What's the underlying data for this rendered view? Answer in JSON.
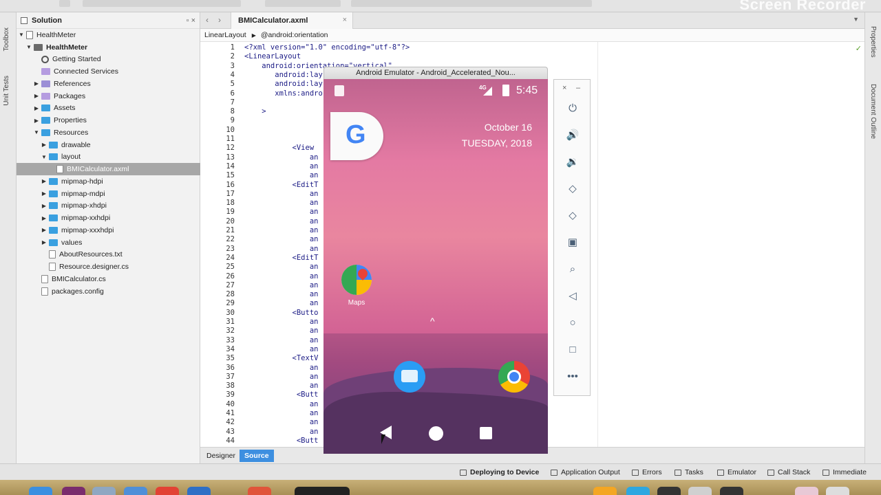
{
  "watermark": "Screen Recorder",
  "left_strip": {
    "tabs": [
      "Toolbox",
      "Unit Tests"
    ]
  },
  "right_strip": {
    "tabs": [
      "Properties",
      "Document Outline"
    ]
  },
  "solution": {
    "title": "Solution",
    "items": [
      {
        "label": "HealthMeter",
        "indent": 0,
        "arrow": "▼",
        "icon": "sln",
        "bold": false
      },
      {
        "label": "HealthMeter",
        "indent": 1,
        "arrow": "▼",
        "icon": "proj",
        "bold": true
      },
      {
        "label": "Getting Started",
        "indent": 2,
        "arrow": "",
        "icon": "gear",
        "bold": false
      },
      {
        "label": "Connected Services",
        "indent": 2,
        "arrow": "",
        "icon": "pkg",
        "bold": false
      },
      {
        "label": "References",
        "indent": 2,
        "arrow": "▶",
        "icon": "ref",
        "bold": false
      },
      {
        "label": "Packages",
        "indent": 2,
        "arrow": "▶",
        "icon": "pkg",
        "bold": false
      },
      {
        "label": "Assets",
        "indent": 2,
        "arrow": "▶",
        "icon": "folder",
        "bold": false
      },
      {
        "label": "Properties",
        "indent": 2,
        "arrow": "▶",
        "icon": "folder",
        "bold": false
      },
      {
        "label": "Resources",
        "indent": 2,
        "arrow": "▼",
        "icon": "folder",
        "bold": false
      },
      {
        "label": "drawable",
        "indent": 3,
        "arrow": "▶",
        "icon": "folder",
        "bold": false
      },
      {
        "label": "layout",
        "indent": 3,
        "arrow": "▼",
        "icon": "folder",
        "bold": false
      },
      {
        "label": "BMICalculator.axml",
        "indent": 4,
        "arrow": "",
        "icon": "file",
        "bold": false,
        "selected": true
      },
      {
        "label": "mipmap-hdpi",
        "indent": 3,
        "arrow": "▶",
        "icon": "folder",
        "bold": false
      },
      {
        "label": "mipmap-mdpi",
        "indent": 3,
        "arrow": "▶",
        "icon": "folder",
        "bold": false
      },
      {
        "label": "mipmap-xhdpi",
        "indent": 3,
        "arrow": "▶",
        "icon": "folder",
        "bold": false
      },
      {
        "label": "mipmap-xxhdpi",
        "indent": 3,
        "arrow": "▶",
        "icon": "folder",
        "bold": false
      },
      {
        "label": "mipmap-xxxhdpi",
        "indent": 3,
        "arrow": "▶",
        "icon": "folder",
        "bold": false
      },
      {
        "label": "values",
        "indent": 3,
        "arrow": "▶",
        "icon": "folder",
        "bold": false
      },
      {
        "label": "AboutResources.txt",
        "indent": 3,
        "arrow": "",
        "icon": "file",
        "bold": false
      },
      {
        "label": "Resource.designer.cs",
        "indent": 3,
        "arrow": "",
        "icon": "file",
        "bold": false
      },
      {
        "label": "BMICalculator.cs",
        "indent": 2,
        "arrow": "",
        "icon": "file",
        "bold": false
      },
      {
        "label": "packages.config",
        "indent": 2,
        "arrow": "",
        "icon": "file",
        "bold": false
      }
    ]
  },
  "editor": {
    "tab_label": "BMICalculator.axml",
    "tab_close": "×",
    "path": [
      "LinearLayout",
      "@android:orientation"
    ],
    "lines": [
      {
        "n": "1",
        "text": "<?xml version=\"1.0\" encoding=\"utf-8\"?>"
      },
      {
        "n": "2",
        "text": "<LinearLayout"
      },
      {
        "n": "3",
        "text": "    android:orientation=\"vertical\""
      },
      {
        "n": "4",
        "text": "       android:lay"
      },
      {
        "n": "5",
        "text": "       android:lay"
      },
      {
        "n": "6",
        "text": "       xmlns:andro"
      },
      {
        "n": "7",
        "text": ""
      },
      {
        "n": "8",
        "text": "    >"
      },
      {
        "n": "9",
        "text": ""
      },
      {
        "n": "10",
        "text": ""
      },
      {
        "n": "11",
        "text": ""
      },
      {
        "n": "12",
        "text": "           <View"
      },
      {
        "n": "13",
        "text": "               an"
      },
      {
        "n": "14",
        "text": "               an"
      },
      {
        "n": "15",
        "text": "               an"
      },
      {
        "n": "16",
        "text": "           <EditT"
      },
      {
        "n": "17",
        "text": "               an"
      },
      {
        "n": "18",
        "text": "               an"
      },
      {
        "n": "19",
        "text": "               an"
      },
      {
        "n": "20",
        "text": "               an"
      },
      {
        "n": "21",
        "text": "               an"
      },
      {
        "n": "22",
        "text": "               an"
      },
      {
        "n": "23",
        "text": "               an"
      },
      {
        "n": "24",
        "text": "           <EditT"
      },
      {
        "n": "25",
        "text": "               an"
      },
      {
        "n": "26",
        "text": "               an"
      },
      {
        "n": "27",
        "text": "               an"
      },
      {
        "n": "28",
        "text": "               an"
      },
      {
        "n": "29",
        "text": "               an"
      },
      {
        "n": "30",
        "text": "           <Butto"
      },
      {
        "n": "31",
        "text": "               an"
      },
      {
        "n": "32",
        "text": "               an"
      },
      {
        "n": "33",
        "text": "               an"
      },
      {
        "n": "34",
        "text": "               an"
      },
      {
        "n": "35",
        "text": "           <TextV"
      },
      {
        "n": "36",
        "text": "               an"
      },
      {
        "n": "37",
        "text": "               an"
      },
      {
        "n": "38",
        "text": "               an"
      },
      {
        "n": "39",
        "text": "            <Butt"
      },
      {
        "n": "40",
        "text": "               an"
      },
      {
        "n": "41",
        "text": "               an"
      },
      {
        "n": "42",
        "text": "               an"
      },
      {
        "n": "43",
        "text": "               an"
      },
      {
        "n": "44",
        "text": "            <Butt"
      }
    ],
    "bottom_tabs": [
      "Designer",
      "Source"
    ]
  },
  "status": {
    "items": [
      "Deploying to Device",
      "Application Output",
      "Errors",
      "Tasks",
      "Emulator",
      "Call Stack",
      "Immediate"
    ]
  },
  "emulator": {
    "title": "Android Emulator - Android_Accelerated_Nou...",
    "status_network": "4G",
    "time": "5:45",
    "google_letter": "G",
    "date_line1": "October 16",
    "date_line2": "TUESDAY, 2018",
    "app_maps_label": "Maps",
    "side_close": "×",
    "side_min": "–",
    "side_buttons": [
      "power-icon",
      "volume-up-icon",
      "volume-down-icon",
      "rotate-left-icon",
      "rotate-right-icon",
      "camera-icon",
      "zoom-icon",
      "back-icon",
      "home-icon",
      "overview-icon",
      "more-icon"
    ]
  }
}
